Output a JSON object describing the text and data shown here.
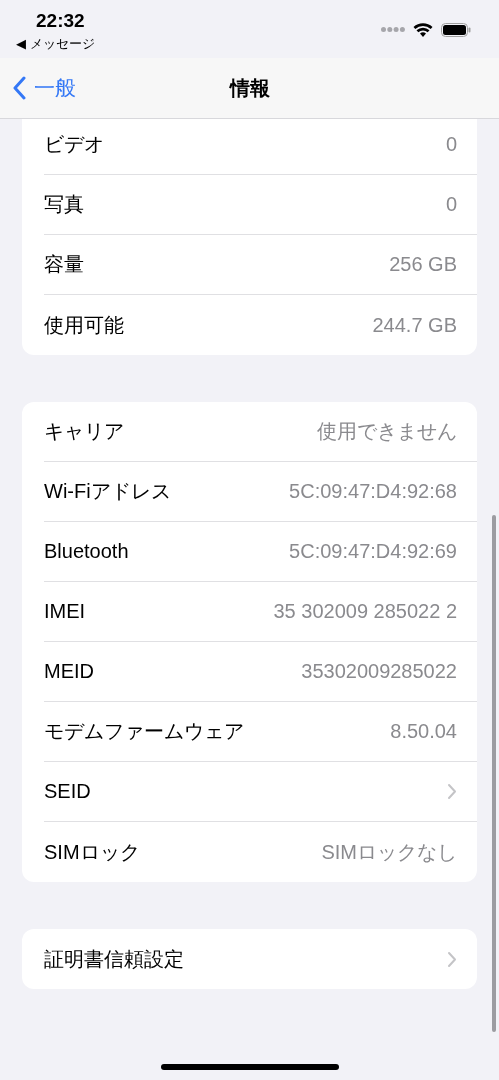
{
  "status_bar": {
    "time": "22:32",
    "back_to_app": "◀ メッセージ"
  },
  "nav": {
    "back_label": "一般",
    "title": "情報"
  },
  "groups": [
    {
      "cut_top": true,
      "rows": [
        {
          "kind": "value",
          "label": "ビデオ",
          "value": "0"
        },
        {
          "kind": "value",
          "label": "写真",
          "value": "0"
        },
        {
          "kind": "value",
          "label": "容量",
          "value": "256 GB"
        },
        {
          "kind": "value",
          "label": "使用可能",
          "value": "244.7 GB"
        }
      ]
    },
    {
      "cut_top": false,
      "rows": [
        {
          "kind": "value",
          "label": "キャリア",
          "value": "使用できません"
        },
        {
          "kind": "value",
          "label": "Wi-Fiアドレス",
          "value": "5C:09:47:D4:92:68"
        },
        {
          "kind": "value",
          "label": "Bluetooth",
          "value": "5C:09:47:D4:92:69"
        },
        {
          "kind": "value",
          "label": "IMEI",
          "value": "35 302009 285022 2"
        },
        {
          "kind": "value",
          "label": "MEID",
          "value": "35302009285022"
        },
        {
          "kind": "value",
          "label": "モデムファームウェア",
          "value": "8.50.04"
        },
        {
          "kind": "chevron",
          "label": "SEID"
        },
        {
          "kind": "value",
          "label": "SIMロック",
          "value": "SIMロックなし"
        }
      ]
    },
    {
      "cut_top": false,
      "rows": [
        {
          "kind": "chevron",
          "label": "証明書信頼設定"
        }
      ]
    }
  ]
}
